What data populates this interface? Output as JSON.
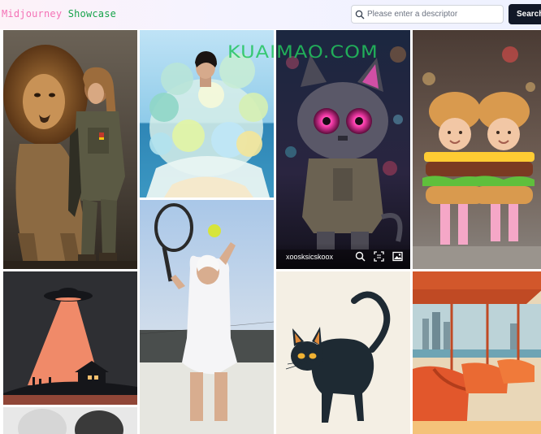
{
  "header": {
    "logo_part1": "Midjourney",
    "logo_part2": "Showcase",
    "search_placeholder": "Please enter a descriptor",
    "search_value": "",
    "search_button": "Search"
  },
  "watermark": "KUAIMAO.COM",
  "gallery": {
    "items": [
      {
        "subject": "woman soldier walking with lion"
      },
      {
        "subject": "woman in balloon dress by the sea"
      },
      {
        "subject": "robot cat with glowing pink eyes",
        "author": "xoosksicskoox"
      },
      {
        "subject": "babies in hamburger costumes"
      },
      {
        "subject": "UFO beam over house"
      },
      {
        "subject": "woman serving tennis ball"
      },
      {
        "subject": "black cat illustration"
      },
      {
        "subject": "orange tram seats by city skyline"
      },
      {
        "subject": "two heads partial"
      }
    ],
    "overlay_icons": [
      "search-icon",
      "scan-icon",
      "image-icon"
    ]
  },
  "colors": {
    "accent": "#111827",
    "logo_pink": "#f472b6",
    "logo_green": "#16a34a",
    "watermark": "#22c55e"
  }
}
